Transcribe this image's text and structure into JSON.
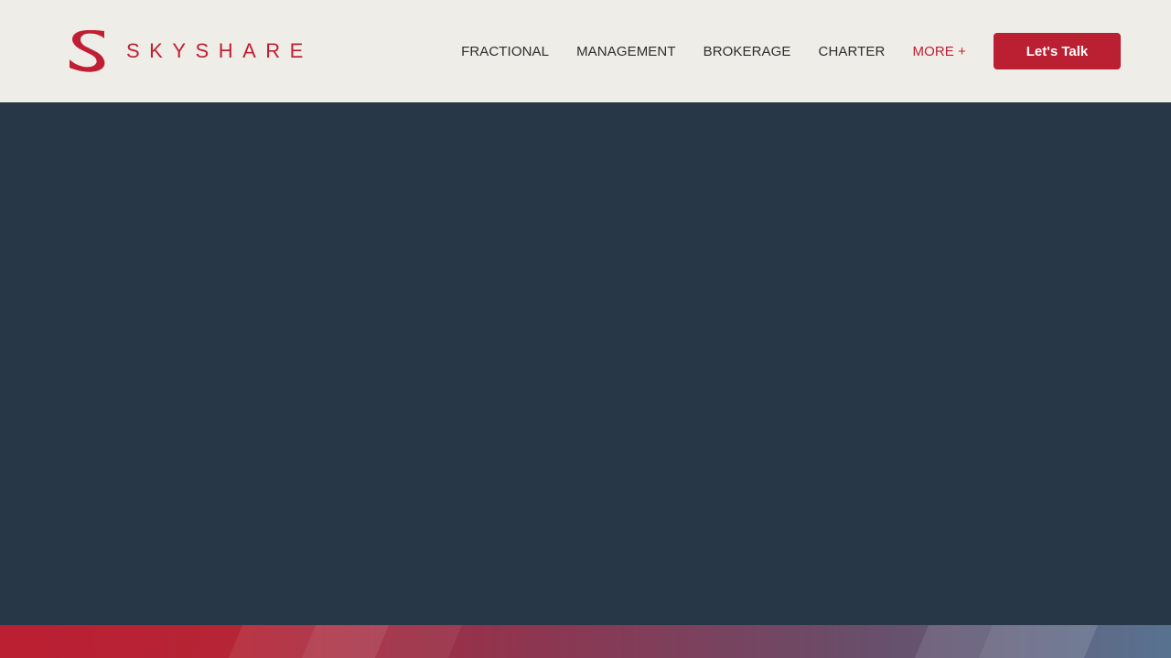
{
  "brand": {
    "name": "SKYSHARE",
    "mark_icon": "skyshare-s-logo",
    "color": "#c01f33"
  },
  "nav": {
    "items": [
      {
        "label": "FRACTIONAL"
      },
      {
        "label": "MANAGEMENT"
      },
      {
        "label": "BROKERAGE"
      },
      {
        "label": "CHARTER"
      },
      {
        "label": "MORE +"
      }
    ]
  },
  "cta": {
    "label": "Let's Talk",
    "color": "#bb1f32"
  },
  "theme": {
    "header_bg": "#efede8",
    "hero_bg": "#283748",
    "stripe_gradient": [
      "#bb1f32",
      "#8c3650",
      "#4f6b8a"
    ]
  }
}
